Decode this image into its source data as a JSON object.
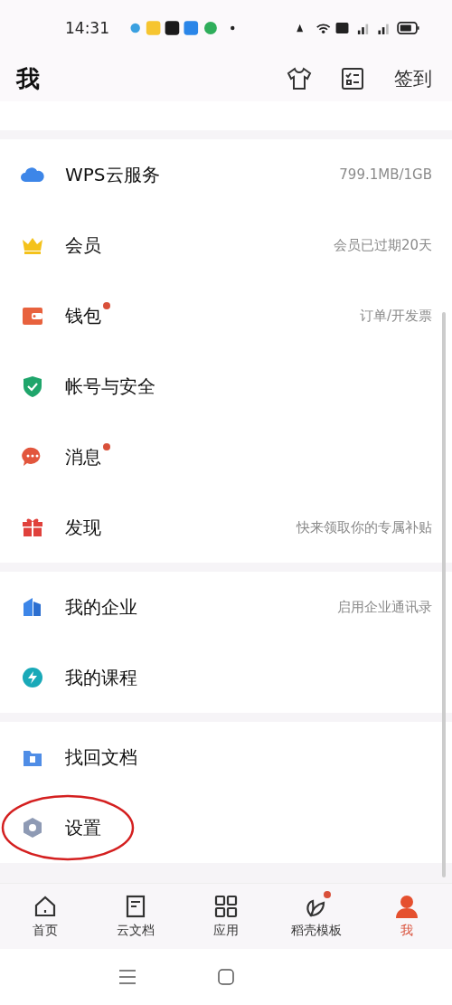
{
  "status_bar": {
    "time": "14:31"
  },
  "header": {
    "title": "我",
    "action": "签到"
  },
  "groups": [
    {
      "items": [
        {
          "kind": "cloud",
          "label": "WPS云服务",
          "detail": "799.1MB/1GB",
          "badge": false
        },
        {
          "kind": "crown",
          "label": "会员",
          "detail": "会员已过期20天",
          "badge": false
        },
        {
          "kind": "wallet",
          "label": "钱包",
          "detail": "订单/开发票",
          "badge": true
        },
        {
          "kind": "shield",
          "label": "帐号与安全",
          "badge": false
        },
        {
          "kind": "chat",
          "label": "消息",
          "badge": true
        },
        {
          "kind": "gift",
          "label": "发现",
          "detail": "快来领取你的专属补贴",
          "badge": false
        }
      ]
    },
    {
      "items": [
        {
          "kind": "building",
          "label": "我的企业",
          "detail": "启用企业通讯录",
          "badge": false
        },
        {
          "kind": "course",
          "label": "我的课程",
          "badge": false
        }
      ]
    },
    {
      "items": [
        {
          "kind": "folder",
          "label": "找回文档",
          "badge": false
        },
        {
          "kind": "gear",
          "label": "设置",
          "badge": false,
          "circled": true
        }
      ]
    }
  ],
  "tabs": [
    {
      "kind": "home",
      "label": "首页",
      "selected": false,
      "badge": false
    },
    {
      "kind": "doc",
      "label": "云文档",
      "selected": false,
      "badge": false
    },
    {
      "kind": "grid",
      "label": "应用",
      "selected": false,
      "badge": false
    },
    {
      "kind": "leaf",
      "label": "稻壳模板",
      "selected": false,
      "badge": true
    },
    {
      "kind": "person",
      "label": "我",
      "selected": true,
      "badge": false
    }
  ]
}
